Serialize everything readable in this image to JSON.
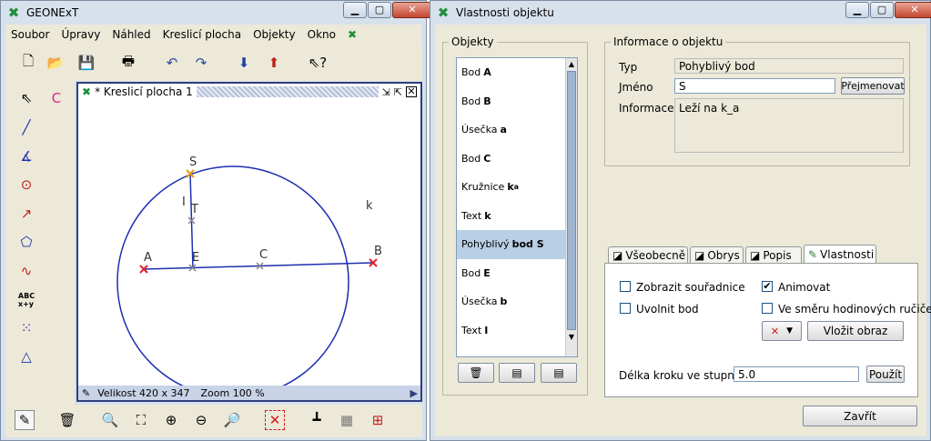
{
  "left_window": {
    "title": "GEONExT",
    "menu": [
      "Soubor",
      "Úpravy",
      "Náhled",
      "Kreslicí plocha",
      "Objekty",
      "Okno"
    ],
    "drawing": {
      "title": "* Kreslicí plocha 1",
      "labels": {
        "S": "S",
        "I": "I",
        "T": "T",
        "A": "A",
        "E": "E",
        "C": "C",
        "B": "B",
        "k": "k"
      },
      "status_size": "Velikost 420 x 347",
      "status_zoom": "Zoom 100 %"
    }
  },
  "right_window": {
    "title": "Vlastnosti objektu",
    "objects_legend": "Objekty",
    "objects": [
      {
        "prefix": "Bod",
        "name": "A"
      },
      {
        "prefix": "Bod",
        "name": "B"
      },
      {
        "prefix": "Úsečka",
        "name": "a"
      },
      {
        "prefix": "Bod",
        "name": "C"
      },
      {
        "prefix": "Kružnice",
        "name": "k",
        "sub": "a"
      },
      {
        "prefix": "Text",
        "name": "k"
      },
      {
        "prefix": "Pohyblivý",
        "name": "bod S"
      },
      {
        "prefix": "Bod",
        "name": "E"
      },
      {
        "prefix": "Úsečka",
        "name": "b"
      },
      {
        "prefix": "Text",
        "name": "I"
      }
    ],
    "info_legend": "Informace o objektu",
    "type_label": "Typ",
    "type_value": "Pohyblivý bod",
    "name_label": "Jméno",
    "name_value": "S",
    "rename_button": "Přejmenovat",
    "info_label": "Informace",
    "info_value": "Leží na k_a",
    "tabs": [
      "Všeobecně",
      "Obrys",
      "Popis",
      "Vlastnosti"
    ],
    "checkboxes": {
      "show_coords": "Zobrazit souřadnice",
      "release_point": "Uvolnit bod",
      "animate": "Animovat",
      "clockwise": "Ve směru hodinových ručiček"
    },
    "insert_image_button": "Vložit obraz",
    "step_label": "Délka kroku ve stupních",
    "step_value": "5.0",
    "apply_button": "Použít",
    "close_button": "Zavřít"
  },
  "colors": {
    "accent": "#2d3e7c",
    "selection": "#b8cfe5",
    "geometry": "#1d2fb0",
    "point": "#e02030"
  }
}
